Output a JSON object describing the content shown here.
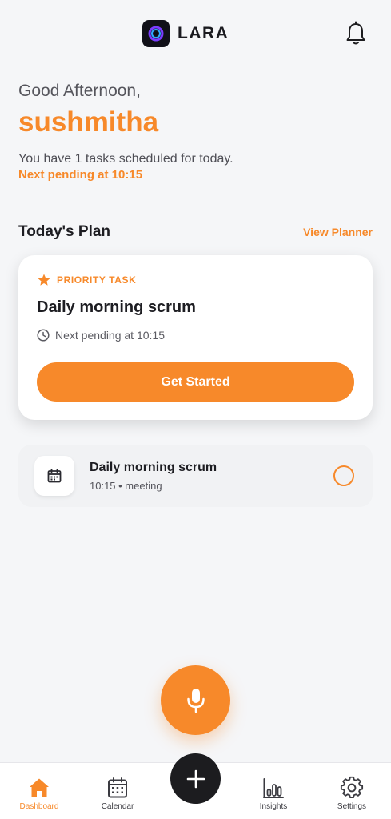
{
  "app": {
    "title": "LARA"
  },
  "greeting": {
    "salutation": "Good Afternoon,",
    "name": "sushmitha",
    "summary": "You have 1 tasks scheduled for today.",
    "next_pending": "Next pending at 10:15"
  },
  "todays_plan": {
    "title": "Today's Plan",
    "view_planner": "View Planner"
  },
  "priority_card": {
    "label": "PRIORITY TASK",
    "title": "Daily morning scrum",
    "pending": "Next pending at 10:15",
    "button": "Get Started"
  },
  "tasks": [
    {
      "title": "Daily morning scrum",
      "meta": "10:15 • meeting",
      "icon": "calendar-icon"
    }
  ],
  "bottom_nav": {
    "items": [
      {
        "label": "Dashboard",
        "icon": "home-icon",
        "active": true
      },
      {
        "label": "Calendar",
        "icon": "calendar-icon",
        "active": false
      },
      {
        "label": "Insights",
        "icon": "bar-chart-icon",
        "active": false
      },
      {
        "label": "Settings",
        "icon": "gear-icon",
        "active": false
      }
    ]
  },
  "colors": {
    "accent": "#f7892a",
    "background": "#f5f6f8",
    "dark": "#1c1c1f"
  }
}
